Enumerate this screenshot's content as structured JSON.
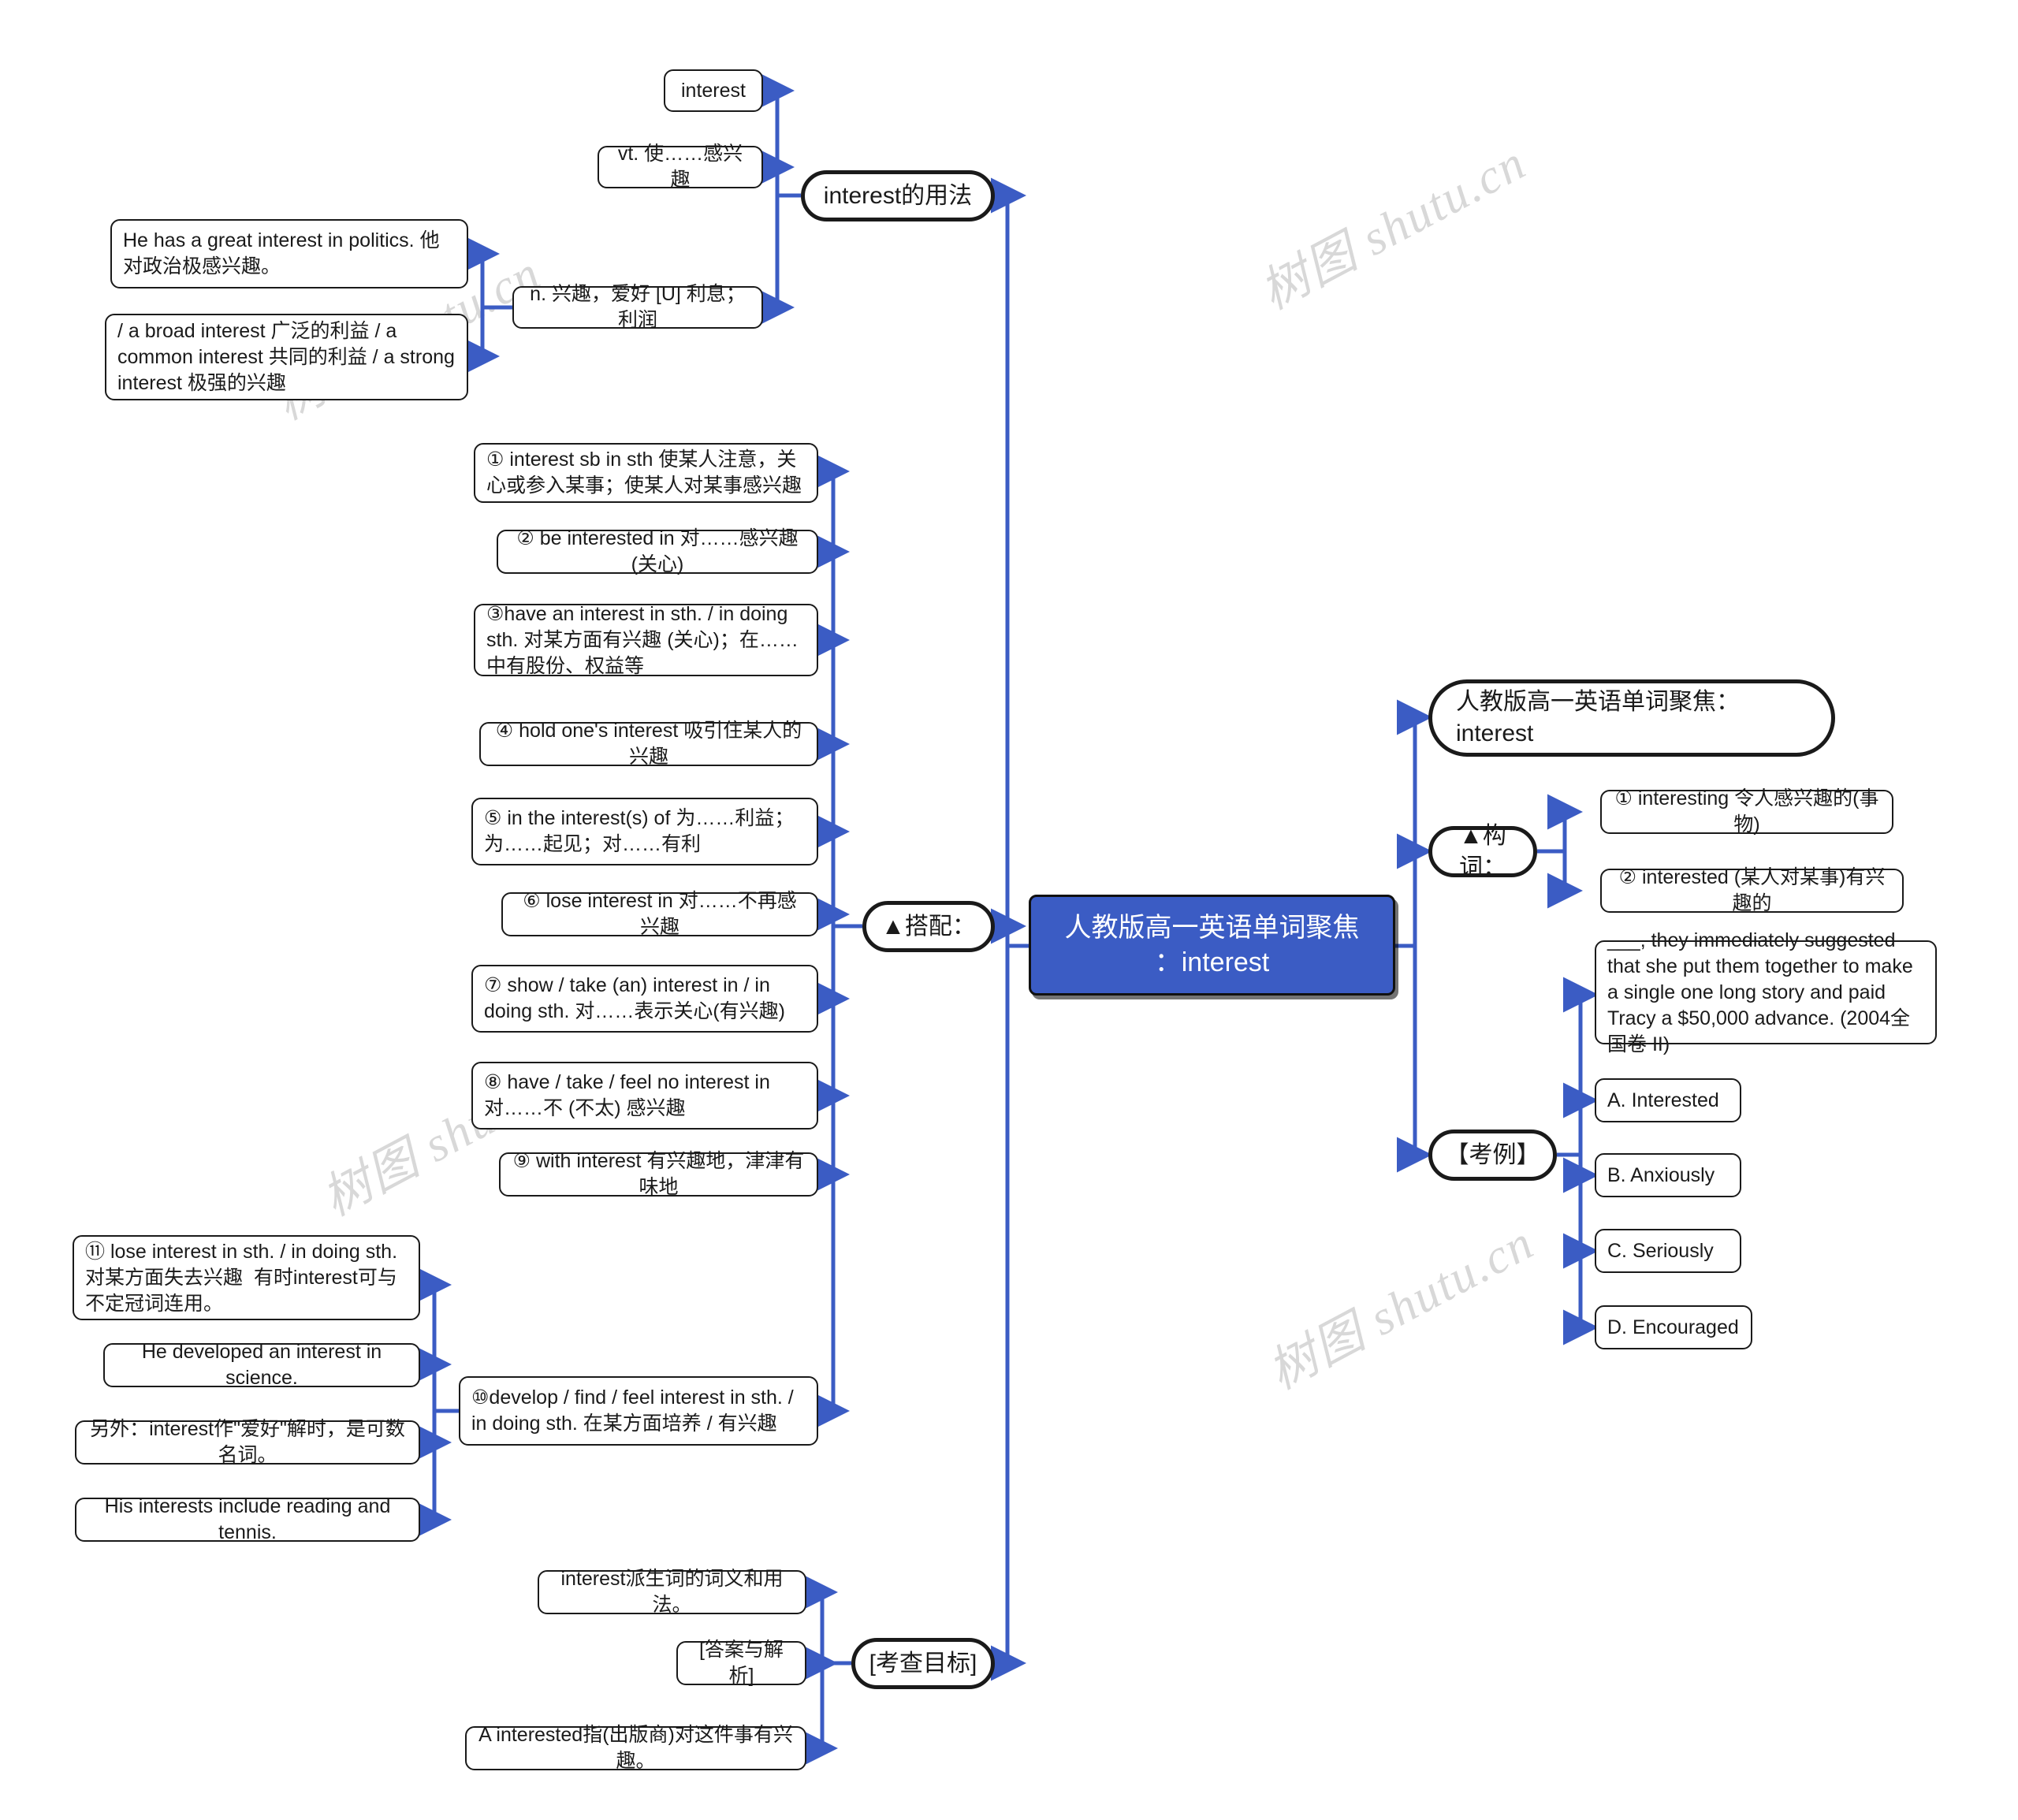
{
  "meta": {
    "title": "人教版高一英语单词聚焦：interest",
    "accent_line_color": "#3b5cc4",
    "root_fill_color": "#3b5cc4",
    "node_border_color": "#1a1a1a",
    "watermark_text": "树图 shutu.cn"
  },
  "root": {
    "label": "人教版高一英语单词聚焦\n：interest"
  },
  "branches": {
    "usage": {
      "label": "interest的用法",
      "children": [
        {
          "label": "interest"
        },
        {
          "label": "vt. 使……感兴趣"
        },
        {
          "label": "n. 兴趣，爱好 [U] 利息；利润",
          "children": [
            {
              "label": "He has a great interest in politics. 他对政治极感兴趣。"
            },
            {
              "label": "/ a broad interest 广泛的利益 / a common interest 共同的利益 / a strong interest 极强的兴趣"
            }
          ]
        }
      ]
    },
    "collocation": {
      "label": "▲搭配：",
      "children": [
        {
          "label": "① interest sb in sth 使某人注意，关心或参入某事；使某人对某事感兴趣"
        },
        {
          "label": "② be interested in 对……感兴趣(关心)"
        },
        {
          "label": "③have an interest in sth. / in doing sth. 对某方面有兴趣 (关心)；在……中有股份、权益等"
        },
        {
          "label": "④ hold one's interest 吸引住某人的兴趣"
        },
        {
          "label": "⑤ in the interest(s) of 为……利益；为……起见；对……有利"
        },
        {
          "label": "⑥ lose interest in 对……不再感兴趣"
        },
        {
          "label": "⑦ show / take (an) interest in / in doing sth. 对……表示关心(有兴趣)"
        },
        {
          "label": "⑧ have / take / feel no interest in 对……不 (不太) 感兴趣"
        },
        {
          "label": "⑨ with interest 有兴趣地，津津有味地"
        },
        {
          "label": "⑩develop / find / feel interest in sth. / in doing sth. 在某方面培养 / 有兴趣",
          "children": [
            {
              "label": "⑪ lose interest in sth. / in doing sth. 对某方面失去兴趣  有时interest可与不定冠词连用。"
            },
            {
              "label": "He developed an interest in science."
            },
            {
              "label": "另外：interest作\"爱好\"解时，是可数名词。"
            },
            {
              "label": "His interests include reading and tennis."
            }
          ]
        }
      ]
    },
    "exam_goal": {
      "label": "[考查目标]",
      "children": [
        {
          "label": "interest派生词的词义和用法。"
        },
        {
          "label": "[答案与解析]"
        },
        {
          "label": "A interested指(出版商)对这件事有兴趣。"
        }
      ]
    },
    "topic": {
      "label": "人教版高一英语单词聚焦：\ninterest"
    },
    "word_formation": {
      "label": "▲构词：",
      "children": [
        {
          "label": "① interesting 令人感兴趣的(事物)"
        },
        {
          "label": "② interested (某人对某事)有兴趣的"
        }
      ]
    },
    "exam_case": {
      "label": "【考例】",
      "children": [
        {
          "label": "___, they immediately suggested that she put them together to make a single one long story and paid Tracy a $50,000 advance. (2004全国卷 II)"
        },
        {
          "label": "A. Interested"
        },
        {
          "label": "B. Anxiously"
        },
        {
          "label": "C. Seriously"
        },
        {
          "label": "D. Encouraged"
        }
      ]
    }
  }
}
